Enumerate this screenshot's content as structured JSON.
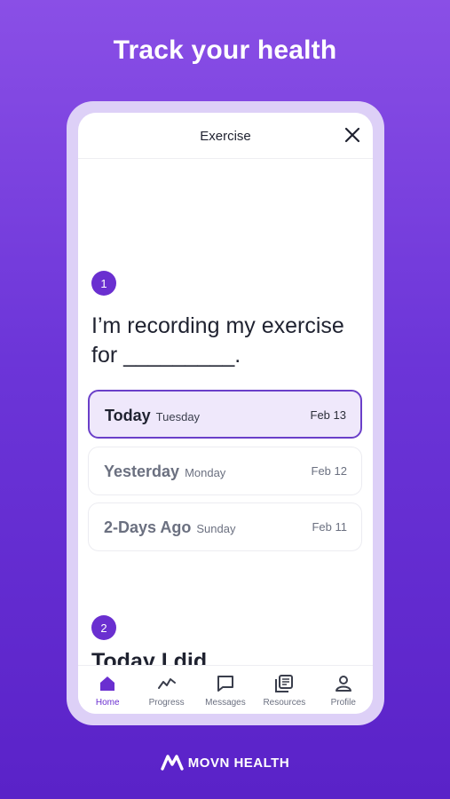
{
  "headline": "Track your health",
  "screen": {
    "title": "Exercise",
    "step1": {
      "number": "1",
      "question": "I’m recording my exercise for _________."
    },
    "options": [
      {
        "label": "Today",
        "day": "Tuesday",
        "date": "Feb 13",
        "selected": true
      },
      {
        "label": "Yesterday",
        "day": "Monday",
        "date": "Feb 12",
        "selected": false
      },
      {
        "label": "2-Days Ago",
        "day": "Sunday",
        "date": "Feb 11",
        "selected": false
      }
    ],
    "step2": {
      "number": "2",
      "question_partial": "Today I did"
    }
  },
  "tabs": [
    {
      "label": "Home",
      "icon": "home-icon",
      "active": true
    },
    {
      "label": "Progress",
      "icon": "trend-line-icon",
      "active": false
    },
    {
      "label": "Messages",
      "icon": "message-icon",
      "active": false
    },
    {
      "label": "Resources",
      "icon": "library-icon",
      "active": false
    },
    {
      "label": "Profile",
      "icon": "person-icon",
      "active": false
    }
  ],
  "brand": {
    "name": "MOVN HEALTH"
  },
  "colors": {
    "accent": "#6a2fd0",
    "background_top": "#8a4fe6",
    "background_bottom": "#5a22c8"
  }
}
